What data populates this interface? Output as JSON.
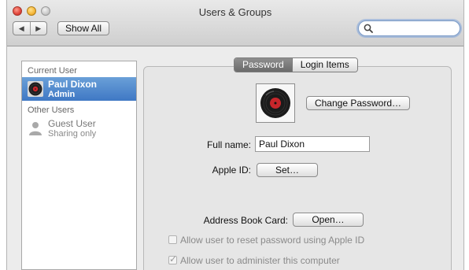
{
  "window": {
    "title": "Users & Groups"
  },
  "toolbar": {
    "back_glyph": "◀",
    "forward_glyph": "▶",
    "show_all_label": "Show All",
    "search_placeholder": ""
  },
  "sidebar": {
    "current_user_header": "Current User",
    "current_user": {
      "name": "Paul Dixon",
      "role": "Admin",
      "icon": "record-avatar-icon"
    },
    "other_users_header": "Other Users",
    "other_users": [
      {
        "name": "Guest User",
        "role": "Sharing only",
        "icon": "person-silhouette-icon"
      }
    ]
  },
  "tabs": [
    {
      "label": "Password",
      "active": true
    },
    {
      "label": "Login Items",
      "active": false
    }
  ],
  "account": {
    "change_password_label": "Change Password…",
    "full_name_label": "Full name:",
    "full_name_value": "Paul Dixon",
    "apple_id_label": "Apple ID:",
    "apple_id_button": "Set…",
    "address_book_label": "Address Book Card:",
    "address_book_button": "Open…",
    "allow_reset_label": "Allow user to reset password using Apple ID",
    "allow_reset_checked": false,
    "allow_admin_label": "Allow user to administer this computer",
    "allow_admin_checked": true
  },
  "colors": {
    "selection": "#3f78c4",
    "window_bg": "#ececec"
  }
}
